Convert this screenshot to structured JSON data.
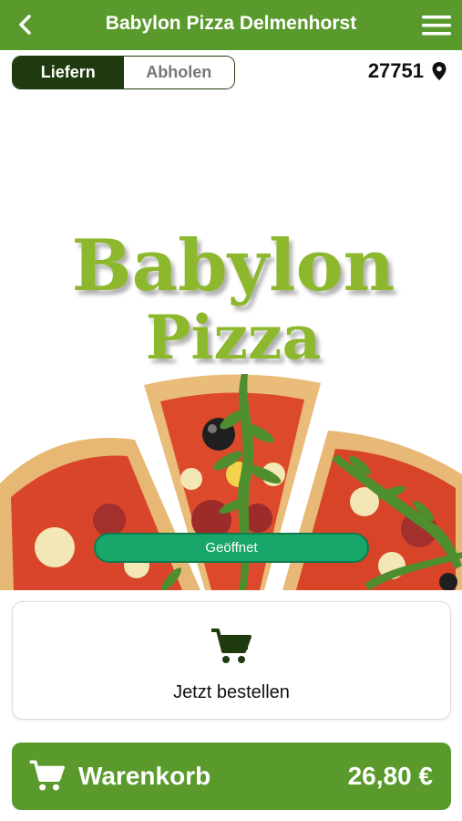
{
  "header": {
    "title": "Babylon Pizza Delmenhorst",
    "back_icon": "chevron-left-icon",
    "menu_icon": "hamburger-menu-icon"
  },
  "delivery_toggle": {
    "options": [
      "Liefern",
      "Abholen"
    ],
    "selected": "Liefern"
  },
  "location": {
    "zip": "27751",
    "icon": "location-pin-icon"
  },
  "hero": {
    "logo_line1": "Babylon",
    "logo_line2": "Pizza",
    "status": "Geöffnet"
  },
  "order_card": {
    "icon": "cart-icon",
    "label": "Jetzt bestellen"
  },
  "basket": {
    "icon": "cart-icon",
    "label": "Warenkorb",
    "amount": "26,80 €"
  },
  "colors": {
    "brand_green": "#5a9a2c",
    "toggle_dark": "#1e3a0e",
    "status_green": "#19a66a",
    "logo_green": "#8db82f"
  }
}
